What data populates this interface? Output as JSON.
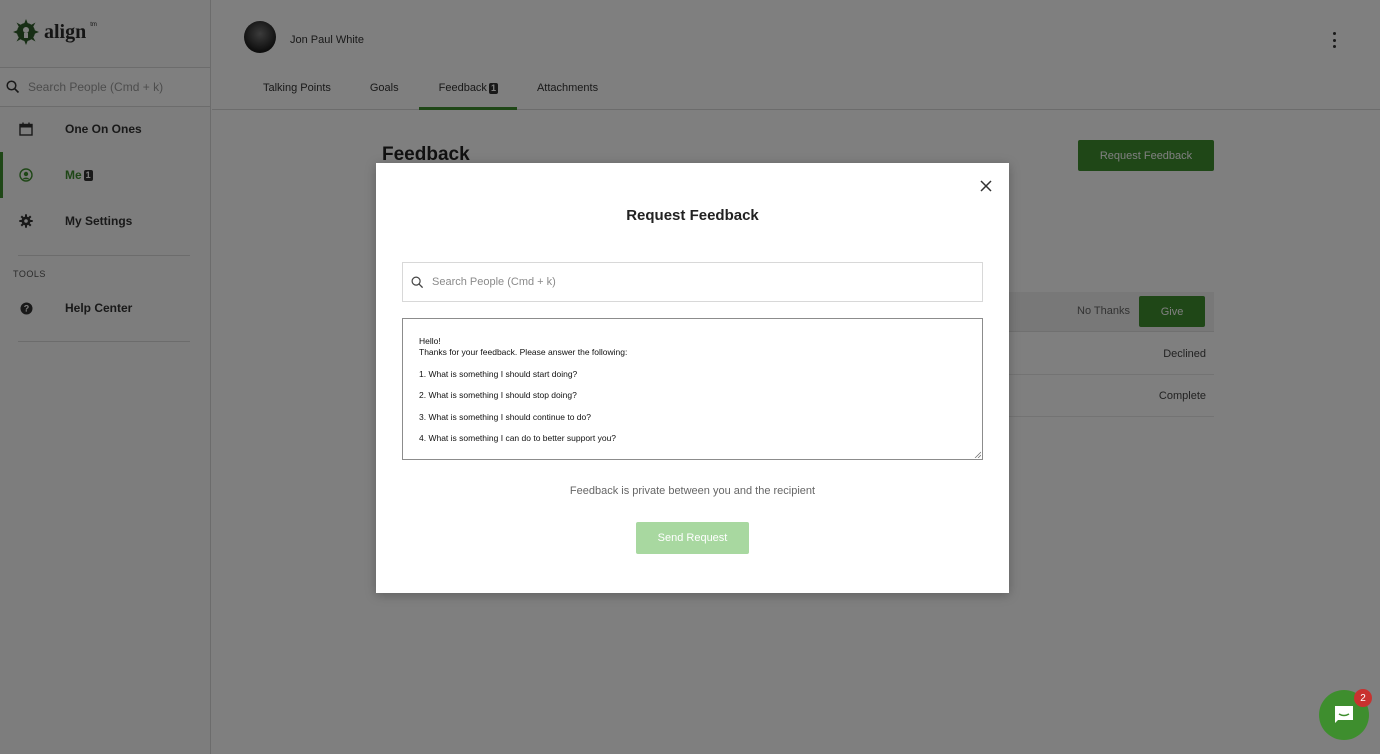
{
  "app": {
    "brand": "align",
    "brand_mark": "tm"
  },
  "sidebar": {
    "search_placeholder": "Search People (Cmd + k)",
    "items": [
      {
        "label": "One On Ones",
        "icon": "calendar-icon"
      },
      {
        "label": "Me",
        "icon": "user-circle-icon",
        "badge": "1",
        "active": true
      },
      {
        "label": "My Settings",
        "icon": "gear-icon"
      }
    ],
    "tools_heading": "TOOLS",
    "tools": [
      {
        "label": "Help Center",
        "icon": "question-circle-icon"
      }
    ]
  },
  "header": {
    "user_name": "Jon Paul White",
    "tabs": [
      {
        "label": "Talking Points"
      },
      {
        "label": "Goals"
      },
      {
        "label": "Feedback",
        "badge": "1",
        "active": true
      },
      {
        "label": "Attachments"
      }
    ]
  },
  "main": {
    "title": "Feedback",
    "request_button": "Request Feedback",
    "list_header": {
      "no_thanks": "No Thanks",
      "give": "Give"
    },
    "rows": [
      {
        "status": "Declined"
      },
      {
        "status": "Complete"
      }
    ]
  },
  "modal": {
    "title": "Request Feedback",
    "search_placeholder": "Search People (Cmd + k)",
    "message": {
      "greeting": "Hello!",
      "intro": "Thanks for your feedback. Please answer the following:",
      "q1": "1. What is something I should start doing?",
      "q2": "2. What is something I should stop doing?",
      "q3": "3. What is something I should continue to do?",
      "q4": "4. What is something I can do to better support you?"
    },
    "privacy_note": "Feedback is private between you and the recipient",
    "send_button": "Send Request"
  },
  "chat": {
    "badge": "2"
  },
  "colors": {
    "accent": "#3e8e2e",
    "accent_disabled": "#a8d8a0",
    "overlay": "rgba(0,0,0,0.5)",
    "notification": "#c8322f"
  }
}
